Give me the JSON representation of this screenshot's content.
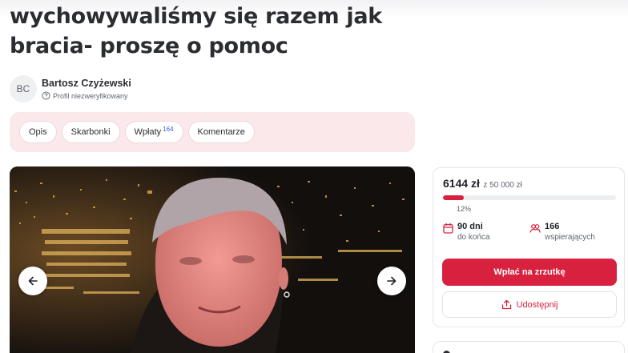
{
  "fundraiser": {
    "title_line1": "wychowywaliśmy się razem jak",
    "title_line2": "bracia- proszę o pomoc"
  },
  "author": {
    "initials": "BC",
    "name": "Bartosz Czyżewski",
    "status": "Profil niezweryfikowany",
    "status_icon": "question-circle-icon"
  },
  "tabs": [
    {
      "label": "Opis",
      "badge": ""
    },
    {
      "label": "Skarbonki",
      "badge": ""
    },
    {
      "label": "Wpłaty",
      "badge": "164"
    },
    {
      "label": "Komentarze",
      "badge": ""
    }
  ],
  "gallery": {
    "prev_icon": "arrow-left-icon",
    "next_icon": "arrow-right-icon"
  },
  "donation_card": {
    "raised": "6144 zł",
    "goal": "z 50 000 zł",
    "progress_pct": 12,
    "progress_label": "12%",
    "days_value": "90 dni",
    "days_label": "do końca",
    "days_icon": "calendar-icon",
    "supporters_value": "166",
    "supporters_label": "wspierających",
    "supporters_icon": "supporters-icon",
    "support_button": "Wpłać na zrzutkę",
    "share_button": "Udostępnij",
    "share_icon": "share-icon"
  },
  "colors": {
    "accent": "#d8213f",
    "tabs_background": "#fbe8ea",
    "tab_badge": "#3a5fd8",
    "text_dark": "#2b2d31",
    "text_muted": "#5f6670"
  }
}
